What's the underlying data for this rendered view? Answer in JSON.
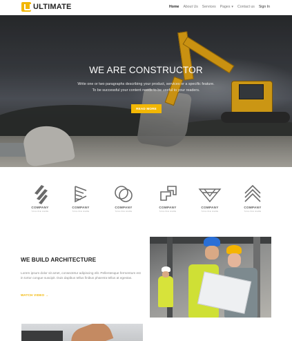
{
  "nav": {
    "logo_text": "ULTIMATE",
    "items": [
      "Home",
      "About Us",
      "Services",
      "Pages",
      "Contact us",
      "Sign In"
    ],
    "active": "Home"
  },
  "hero": {
    "title": "WE ARE CONSTRUCTOR",
    "text_line1": "Write one or two paragraphs describing your product, services or a specific feature.",
    "text_line2": "To be successful your content needs to be useful to your readers.",
    "button_label": "READ MORE"
  },
  "brands": [
    {
      "name": "COMPANY",
      "tagline": "TAGLINE HERE"
    },
    {
      "name": "COMPANY",
      "tagline": "TAGLINE HERE"
    },
    {
      "name": "COMPANY",
      "tagline": "TAGLINE HERE"
    },
    {
      "name": "COMPANY",
      "tagline": "TAGLINE HERE"
    },
    {
      "name": "COMPANY",
      "tagline": "TAGLINE HERE"
    },
    {
      "name": "COMPANY",
      "tagline": "TAGLINE HERE"
    }
  ],
  "architecture": {
    "title": "WE BUILD ARCHITECTURE",
    "text": "Lorem ipsum dolor sit amet, consectetur adipiscing elit. Pellentesque fermentum est in tortor congue suscipit. Duis dapibus tellus finibus pharetra tellus at egestas.",
    "link_label": "WATCH VIDEO →"
  },
  "colors": {
    "accent": "#f2b705",
    "text_dark": "#222222",
    "text_muted": "#888888"
  }
}
